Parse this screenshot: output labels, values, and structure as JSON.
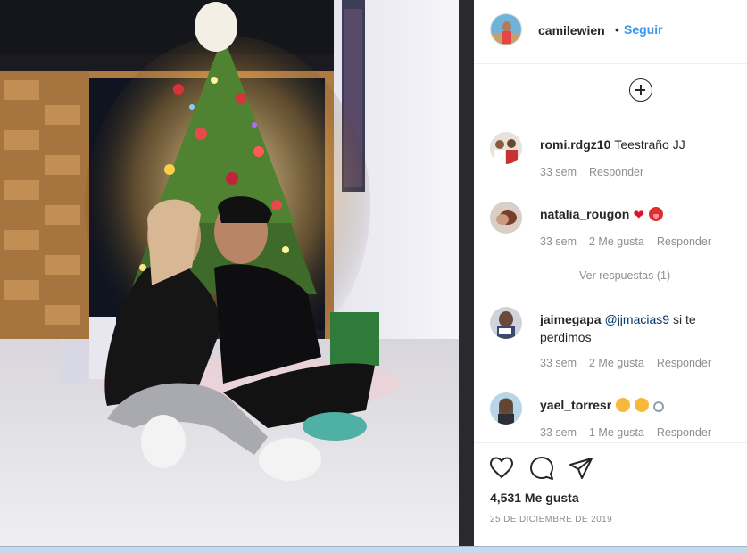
{
  "post": {
    "author": "camilewien",
    "separator": "•",
    "follow_label": "Seguir"
  },
  "comments": [
    {
      "user": "romi.rdgz10",
      "text": "Teestraño JJ",
      "time": "33 sem",
      "likes": "",
      "reply_label": "Responder"
    },
    {
      "user": "natalia_rougon",
      "text": "",
      "emoji": [
        "red-heart",
        "tongue-face"
      ],
      "time": "33 sem",
      "likes": "2 Me gusta",
      "reply_label": "Responder"
    },
    {
      "user": "jaimegapa",
      "mention": "@jjmacias9",
      "text": "si te perdimos",
      "time": "33 sem",
      "likes": "2 Me gusta",
      "reply_label": "Responder"
    },
    {
      "user": "yael_torresr",
      "text": "",
      "emoji": [
        "heart-eyes",
        "heart-eyes",
        "ring"
      ],
      "time": "33 sem",
      "likes": "1 Me gusta",
      "reply_label": "Responder"
    }
  ],
  "view_replies_label": "Ver respuestas (1)",
  "actions": {
    "likes_count": "4,531 Me gusta",
    "date": "25 DE DICIEMBRE DE 2019"
  },
  "icons": {
    "add_comment": "plus-circle-icon",
    "like": "heart-outline-icon",
    "comment": "comment-bubble-icon",
    "share": "paper-plane-icon"
  },
  "colors": {
    "follow": "#3897f0",
    "text": "#262626",
    "muted": "#8e8e8e",
    "mention": "#003569"
  }
}
